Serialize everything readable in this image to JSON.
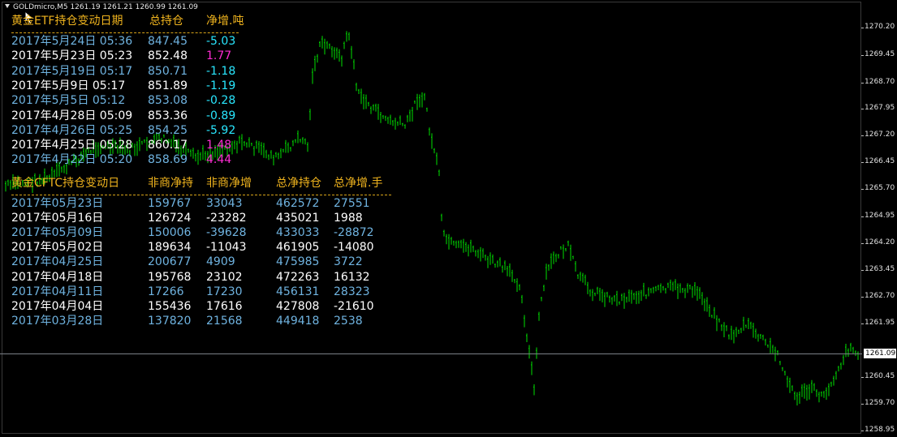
{
  "window": {
    "symbol_line": "GOLDmicro,M5  1261.19 1261.21 1260.99 1261.09"
  },
  "price_axis": {
    "ticks": [
      "1270.20",
      "1269.45",
      "1268.70",
      "1267.95",
      "1267.20",
      "1266.45",
      "1265.70",
      "1264.95",
      "1264.20",
      "1263.45",
      "1262.70",
      "1261.95",
      "1260.45",
      "1259.70",
      "1258.95"
    ],
    "current_price": "1261.09"
  },
  "colors": {
    "background": "#000000",
    "candle_green": "#00e000",
    "header_gold": "#f0b41e",
    "row_blue": "#6fb3e0",
    "row_white": "#ffffff",
    "change_cyan": "#29e7ff",
    "change_magenta": "#ff2bd4"
  },
  "etf_table": {
    "headers": [
      "黄金ETF持仓变动日期",
      "总持仓",
      "净增.吨"
    ],
    "rows": [
      {
        "date": "2017年5月24日 05:36",
        "total": "847.45",
        "change": "-5.03",
        "change_color": "#29e7ff"
      },
      {
        "date": "2017年5月23日 05:23",
        "total": "852.48",
        "change": "1.77",
        "change_color": "#ff2bd4"
      },
      {
        "date": "2017年5月19日 05:17",
        "total": "850.71",
        "change": "-1.18",
        "change_color": "#29e7ff"
      },
      {
        "date": "2017年5月9日 05:17",
        "total": "851.89",
        "change": "-1.19",
        "change_color": "#29e7ff"
      },
      {
        "date": "2017年5月5日 05:12",
        "total": "853.08",
        "change": "-0.28",
        "change_color": "#29e7ff"
      },
      {
        "date": "2017年4月28日 05:09",
        "total": "853.36",
        "change": "-0.89",
        "change_color": "#29e7ff"
      },
      {
        "date": "2017年4月26日 05:25",
        "total": "854.25",
        "change": "-5.92",
        "change_color": "#29e7ff"
      },
      {
        "date": "2017年4月25日 05:28",
        "total": "860.17",
        "change": "1.48",
        "change_color": "#ff2bd4"
      },
      {
        "date": "2017年4月22日 05:20",
        "total": "858.69",
        "change": "4.44",
        "change_color": "#ff2bd4"
      }
    ]
  },
  "cftc_table": {
    "headers": [
      "黄金CFTC持仓变动日",
      "非商净持",
      "非商净增",
      "总净持仓",
      "总净增.手"
    ],
    "rows": [
      {
        "date": "2017年05月23日",
        "noncomm_net": "159767",
        "noncomm_change": "33043",
        "total_net": "462572",
        "total_change": "27551"
      },
      {
        "date": "2017年05月16日",
        "noncomm_net": "126724",
        "noncomm_change": "-23282",
        "total_net": "435021",
        "total_change": "1988"
      },
      {
        "date": "2017年05月09日",
        "noncomm_net": "150006",
        "noncomm_change": "-39628",
        "total_net": "433033",
        "total_change": "-28872"
      },
      {
        "date": "2017年05月02日",
        "noncomm_net": "189634",
        "noncomm_change": "-11043",
        "total_net": "461905",
        "total_change": "-14080"
      },
      {
        "date": "2017年04月25日",
        "noncomm_net": "200677",
        "noncomm_change": "4909",
        "total_net": "475985",
        "total_change": "3722"
      },
      {
        "date": "2017年04月18日",
        "noncomm_net": "195768",
        "noncomm_change": "23102",
        "total_net": "472263",
        "total_change": "16132"
      },
      {
        "date": "2017年04月11日",
        "noncomm_net": "17266",
        "noncomm_change": "17230",
        "total_net": "456131",
        "total_change": "28323"
      },
      {
        "date": "2017年04月04日",
        "noncomm_net": "155436",
        "noncomm_change": "17616",
        "total_net": "427808",
        "total_change": "-21610"
      },
      {
        "date": "2017年03月28日",
        "noncomm_net": "137820",
        "noncomm_change": "21568",
        "total_net": "449418",
        "total_change": "2538"
      }
    ]
  }
}
